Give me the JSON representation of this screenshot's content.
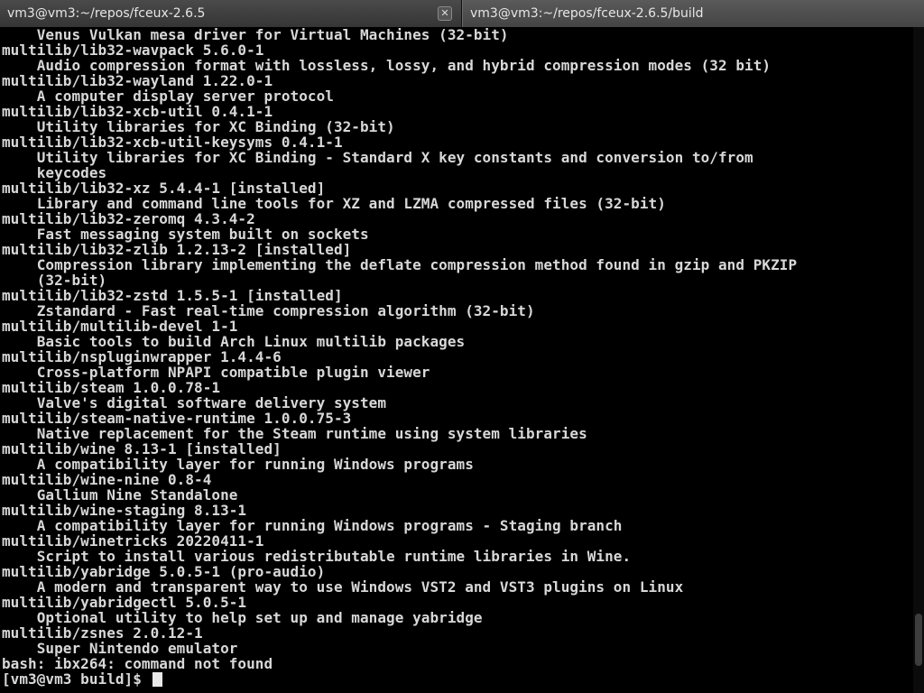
{
  "tabs": [
    {
      "label": "vm3@vm3:~/repos/fceux-2.6.5",
      "close": "✕",
      "active": false
    },
    {
      "label": "vm3@vm3:~/repos/fceux-2.6.5/build",
      "active": true
    }
  ],
  "terminal": {
    "lines": [
      "    Venus Vulkan mesa driver for Virtual Machines (32-bit)",
      "multilib/lib32-wavpack 5.6.0-1",
      "    Audio compression format with lossless, lossy, and hybrid compression modes (32 bit)",
      "multilib/lib32-wayland 1.22.0-1",
      "    A computer display server protocol",
      "multilib/lib32-xcb-util 0.4.1-1",
      "    Utility libraries for XC Binding (32-bit)",
      "multilib/lib32-xcb-util-keysyms 0.4.1-1",
      "    Utility libraries for XC Binding - Standard X key constants and conversion to/from",
      "    keycodes",
      "multilib/lib32-xz 5.4.4-1 [installed]",
      "    Library and command line tools for XZ and LZMA compressed files (32-bit)",
      "multilib/lib32-zeromq 4.3.4-2",
      "    Fast messaging system built on sockets",
      "multilib/lib32-zlib 1.2.13-2 [installed]",
      "    Compression library implementing the deflate compression method found in gzip and PKZIP",
      "    (32-bit)",
      "multilib/lib32-zstd 1.5.5-1 [installed]",
      "    Zstandard - Fast real-time compression algorithm (32-bit)",
      "multilib/multilib-devel 1-1",
      "    Basic tools to build Arch Linux multilib packages",
      "multilib/nspluginwrapper 1.4.4-6",
      "    Cross-platform NPAPI compatible plugin viewer",
      "multilib/steam 1.0.0.78-1",
      "    Valve's digital software delivery system",
      "multilib/steam-native-runtime 1.0.0.75-3",
      "    Native replacement for the Steam runtime using system libraries",
      "multilib/wine 8.13-1 [installed]",
      "    A compatibility layer for running Windows programs",
      "multilib/wine-nine 0.8-4",
      "    Gallium Nine Standalone",
      "multilib/wine-staging 8.13-1",
      "    A compatibility layer for running Windows programs - Staging branch",
      "multilib/winetricks 20220411-1",
      "    Script to install various redistributable runtime libraries in Wine.",
      "multilib/yabridge 5.0.5-1 (pro-audio)",
      "    A modern and transparent way to use Windows VST2 and VST3 plugins on Linux",
      "multilib/yabridgectl 5.0.5-1",
      "    Optional utility to help set up and manage yabridge",
      "multilib/zsnes 2.0.12-1",
      "    Super Nintendo emulator",
      "bash: ibx264: command not found"
    ],
    "prompt": "[vm3@vm3 build]$ ",
    "input": ""
  },
  "colors": {
    "background": "#000000",
    "text": "#d8d8d8",
    "tab_bar": "#1a1a1a"
  }
}
